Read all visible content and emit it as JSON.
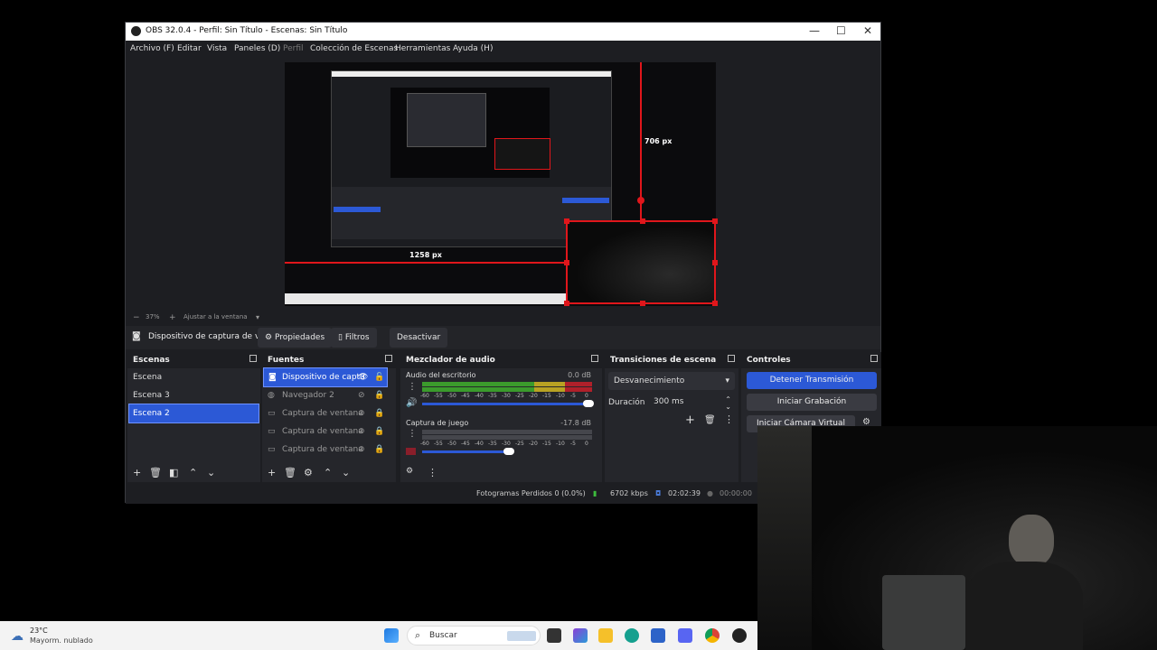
{
  "window": {
    "title": "OBS 32.0.4 - Perfil: Sin Título - Escenas: Sin Título",
    "controls": [
      "—",
      "☐",
      "✕"
    ]
  },
  "menu": [
    "Archivo (F)",
    "Editar",
    "Vista",
    "Paneles (D)",
    "Perfil",
    "Colección de Escenas",
    "Herramientas",
    "Ayuda (H)"
  ],
  "preview": {
    "measure_h": "1258 px",
    "measure_v": "706 px"
  },
  "zoom": {
    "minus": "−",
    "value": "37%",
    "plus": "+",
    "fit": "Ajustar a la ventana"
  },
  "source_toolbar": {
    "selected": "Dispositivo de captura de v",
    "properties": "Propiedades",
    "filters": "Filtros",
    "deactivate": "Desactivar"
  },
  "scenes": {
    "title": "Escenas",
    "items": [
      "Escena",
      "Escena 3",
      "Escena 2"
    ]
  },
  "sources": {
    "title": "Fuentes",
    "items": [
      "Dispositivo de captu",
      "Navegador 2",
      "Captura de ventana",
      "Captura de ventana",
      "Captura de ventana"
    ]
  },
  "mixer": {
    "title": "Mezclador de audio",
    "channels": [
      {
        "name": "Audio del escritorio",
        "db": "0.0 dB"
      },
      {
        "name": "Captura de juego",
        "db": "-17.8 dB"
      }
    ],
    "scale": [
      "-60",
      "-55",
      "-50",
      "-45",
      "-40",
      "-35",
      "-30",
      "-25",
      "-20",
      "-15",
      "-10",
      "-5",
      "0"
    ]
  },
  "transitions": {
    "title": "Transiciones de escena",
    "type": "Desvanecimiento",
    "duration_label": "Duración",
    "duration_value": "300 ms"
  },
  "controls": {
    "title": "Controles",
    "stop_stream": "Detener Transmisión",
    "start_recording": "Iniciar Grabación",
    "virtual_cam": "Iniciar Cámara Virtual"
  },
  "status": {
    "dropped": "Fotogramas Perdidos 0 (0.0%)",
    "kbps": "6702 kbps",
    "live_time": "02:02:39",
    "rec_time": "00:00:00"
  },
  "taskbar": {
    "temp": "23°C",
    "weather": "Mayorm. nublado",
    "search": "Buscar"
  },
  "colors": {
    "accent": "#2c59d6",
    "guide_red": "#e0161b"
  }
}
